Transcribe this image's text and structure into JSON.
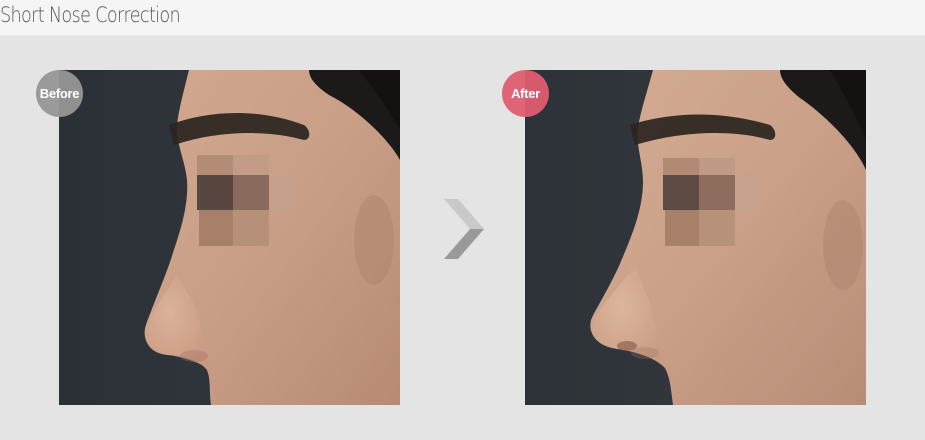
{
  "header": {
    "title": "Short Nose Correction"
  },
  "comparison": {
    "before": {
      "badge_label": "Before"
    },
    "after": {
      "badge_label": "After"
    },
    "arrow_icon": "chevron-right-icon"
  },
  "colors": {
    "before_badge": "#969696",
    "after_badge": "#df5c70",
    "header_bg": "#f5f5f5",
    "page_bg": "#e4e4e4"
  }
}
